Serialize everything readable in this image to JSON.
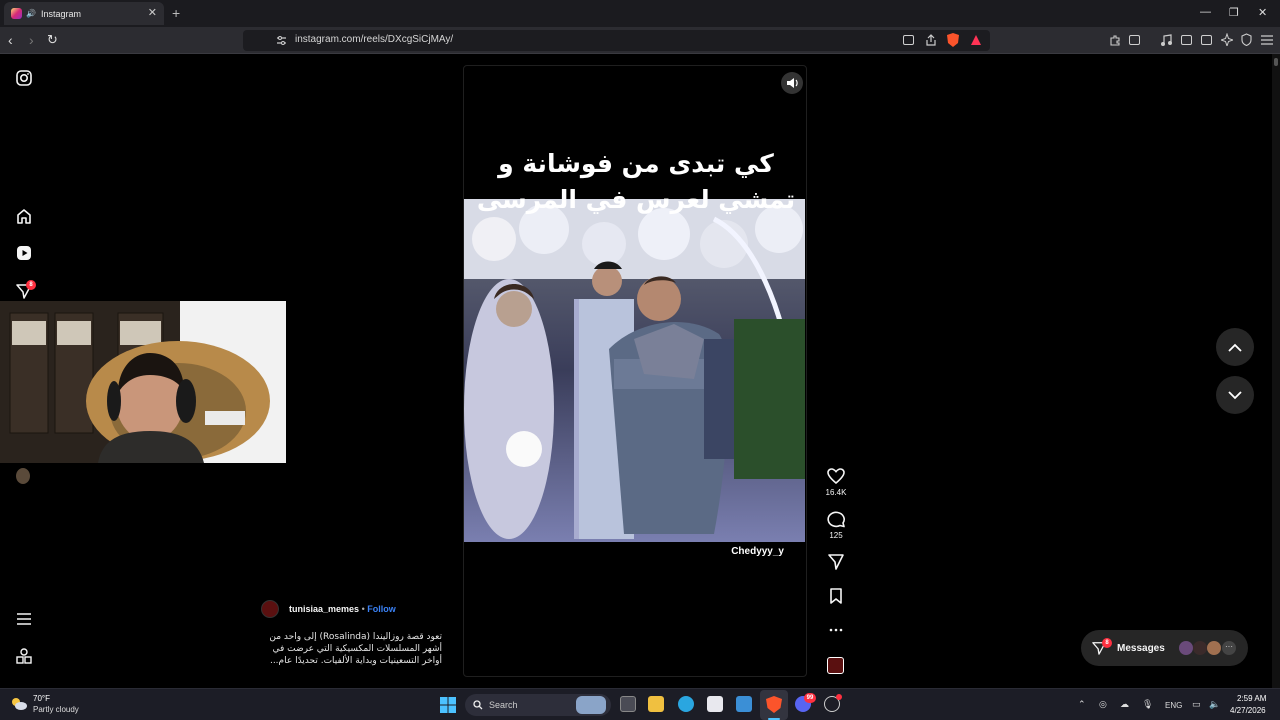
{
  "browser": {
    "tab_title": "Instagram",
    "url": "instagram.com/reels/DXcgSiCjMAy/"
  },
  "sidebar": {
    "notification_count": "8"
  },
  "reel": {
    "title_line1": "كي تبدى من فوشانة و",
    "title_line2": "تمشي لعرس في المرسى",
    "watermark": "Chedyyy_y",
    "likes": "16.4K",
    "comments": "125",
    "author": "tunisiaa_memes",
    "separator": "•",
    "follow_label": "Follow",
    "description": "تعود قصة روزاليندا (Rosalinda) إلى واحد من أشهر المسلسلات المكسيكية التي عرضت في أواخر التسعينيات وبداية الألفيات. تحديدًا عام..."
  },
  "messages": {
    "label": "Messages",
    "badge": "8"
  },
  "taskbar": {
    "weather_temp": "70°F",
    "weather_desc": "Partly cloudy",
    "search_label": "Search",
    "discord_badge": "99",
    "lang": "ENG",
    "time": "2:59 AM",
    "date": "4/27/2026"
  },
  "colors": {
    "follow": "#3b82f6",
    "badge": "#ff3040",
    "background": "#000000"
  }
}
